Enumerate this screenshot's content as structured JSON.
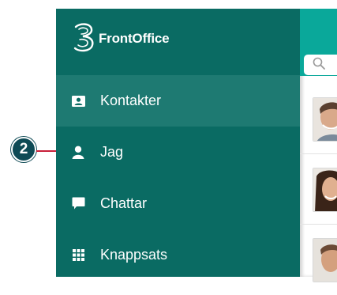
{
  "callout": {
    "number": "2"
  },
  "app": {
    "logo_text": "FrontOffice"
  },
  "menu": {
    "items": [
      {
        "label": "Kontakter",
        "icon": "contacts-icon",
        "active": true
      },
      {
        "label": "Jag",
        "icon": "person-icon",
        "active": false
      },
      {
        "label": "Chattar",
        "icon": "chat-icon",
        "active": false
      },
      {
        "label": "Knappsats",
        "icon": "keypad-icon",
        "active": false
      }
    ]
  },
  "search": {
    "icon": "search-icon"
  },
  "colors": {
    "drawer_bg": "#0a6b63",
    "drawer_active": "#1e7a72",
    "header_accent": "#0aa89a",
    "callout_badge": "#0e4a55",
    "callout_line": "#c8203a"
  }
}
